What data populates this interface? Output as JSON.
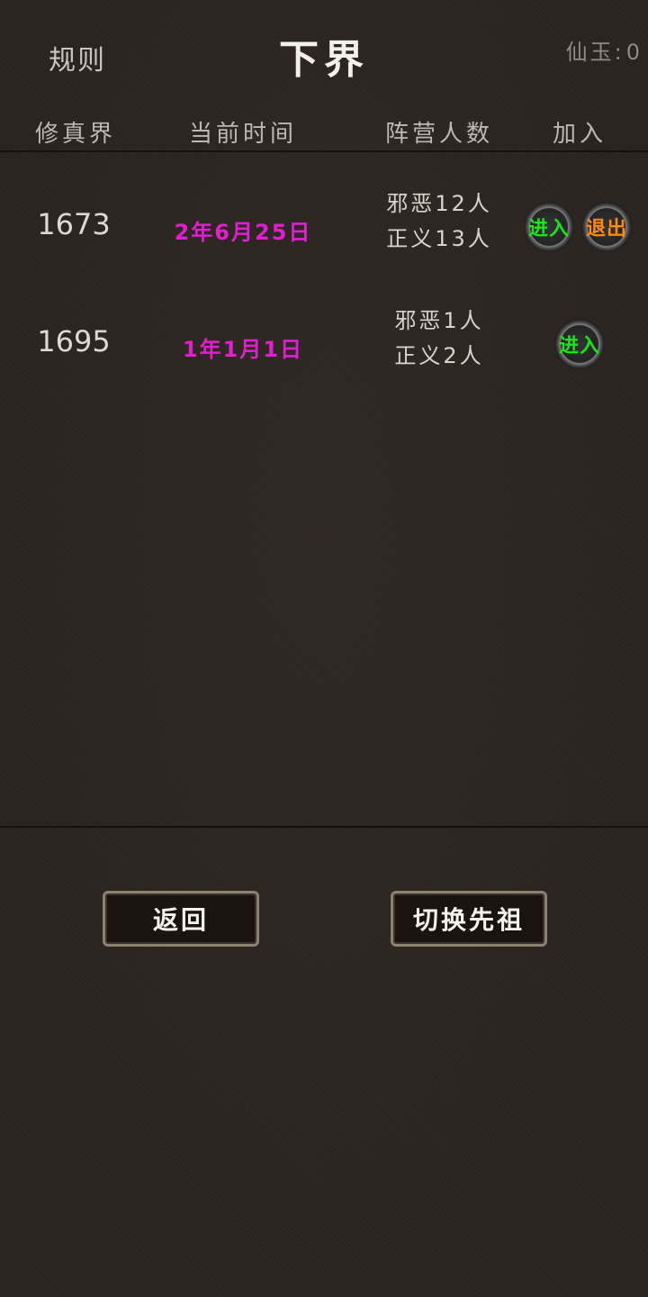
{
  "header": {
    "rules_label": "规则",
    "title": "下界",
    "jade_label": "仙玉:",
    "jade_value": "0"
  },
  "columns": [
    "修真界",
    "当前时间",
    "阵营人数",
    "加入"
  ],
  "rows": [
    {
      "realm": "1673",
      "time": "2年6月25日",
      "evil": "邪恶12人",
      "good": "正义13人",
      "enter_label": "进入",
      "exit_label": "退出"
    },
    {
      "realm": "1695",
      "time": "1年1月1日",
      "evil": "邪恶1人",
      "good": "正义2人",
      "enter_label": "进入"
    }
  ],
  "footer": {
    "back_label": "返回",
    "switch_label": "切换先祖"
  },
  "colors": {
    "time": "#e020d0",
    "enter": "#19e619",
    "exit": "#ff8a10",
    "background": "#2a231f"
  }
}
